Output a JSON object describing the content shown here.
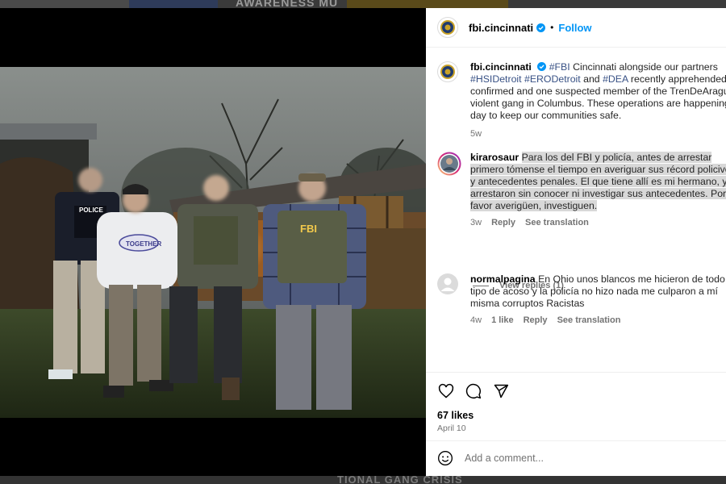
{
  "backdrop": {
    "top_text": "AWARENESS MU",
    "bottom_text": "TIONAL GANG CRISIS"
  },
  "post": {
    "username": "fbi.cincinnati",
    "follow_label": "Follow",
    "caption": {
      "username": "fbi.cincinnati",
      "tag1": "#FBI",
      "text1": " Cincinnati alongside our partners",
      "tag2": "#HSIDetroit",
      "tag3": "#ERODetroit",
      "and_word": " and ",
      "tag4": "#DEA",
      "text2": " recently apprehended on",
      "line3": "confirmed and one suspected member of the TrenDeAragua",
      "line4": "violent gang in Columbus. These operations are happening e",
      "line5": "day to keep our communities safe.",
      "time": "5w"
    },
    "photo_labels": {
      "vest_police": "POLICE",
      "vest_fbi": "FBI",
      "sweatshirt": "TOGETHER"
    },
    "likes": "67 likes",
    "date": "April 10",
    "add_comment_placeholder": "Add a comment..."
  },
  "comments": [
    {
      "username": "kirarosaur",
      "lines": [
        "Para los del FBI y policía, antes de arrestar",
        "primero tómense el tiempo en averiguar sus récord policivos",
        "y antecedentes penales. El que tiene allí es mi hermano, y lo",
        "arrestaron sin conocer ni investigar sus antecedentes. Por",
        "favor averigüen, investiguen."
      ],
      "time": "3w",
      "reply_label": "Reply",
      "translate_label": "See translation",
      "view_replies": "View replies (1)"
    },
    {
      "username": "normalpagina",
      "lines": [
        "En Ohio unos blancos me hicieron de todo",
        "tipo de acoso y la policía no hizo nada me culparon a mí",
        "misma corruptos Racistas"
      ],
      "time": "4w",
      "likes": "1 like",
      "reply_label": "Reply",
      "translate_label": "See translation"
    }
  ],
  "icons": {
    "like": "heart-icon",
    "comment": "comment-icon",
    "share": "share-icon",
    "emoji": "emoji-icon",
    "verified": "verified-badge-icon"
  },
  "colors": {
    "link_blue": "#0095f6",
    "hashtag": "#00376b",
    "verified": "#0095f6",
    "muted": "#737373"
  }
}
